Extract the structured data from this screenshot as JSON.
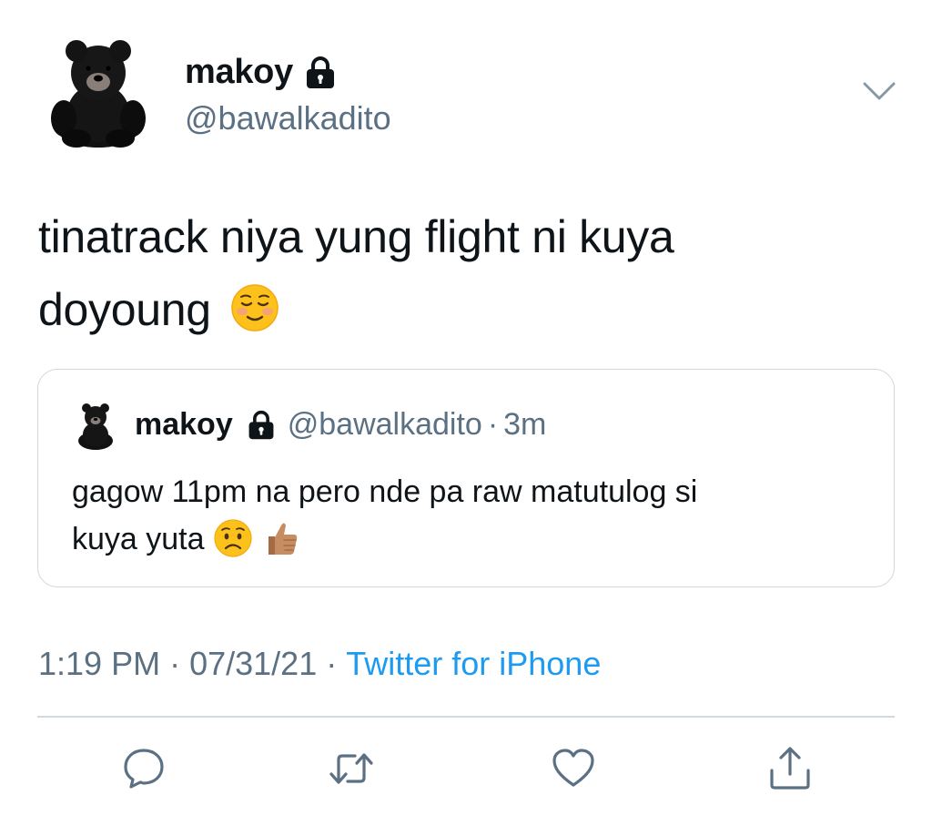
{
  "tweet": {
    "author": {
      "display_name": "makoy",
      "handle": "@bawalkadito",
      "avatar_icon": "teddy-bear-avatar",
      "protected_icon": "lock-icon"
    },
    "text_line1": "tinatrack niya yung flight ni kuya",
    "text_line2": "doyoung",
    "text_emoji": "smiling-face-emoji"
  },
  "quote": {
    "author": {
      "display_name": "makoy",
      "handle": "@bawalkadito",
      "separator": "·",
      "time": "3m"
    },
    "text_line1": "gagow 11pm na pero nde pa raw matutulog si",
    "text_line2": "kuya yuta",
    "emojis": [
      "worried-face-emoji",
      "thumbs-up-emoji"
    ]
  },
  "meta": {
    "time": "1:19 PM",
    "separator": "·",
    "date": "07/31/21",
    "source": "Twitter for iPhone"
  },
  "actions": [
    {
      "name": "reply",
      "icon": "reply-icon"
    },
    {
      "name": "retweet",
      "icon": "retweet-icon"
    },
    {
      "name": "like",
      "icon": "heart-icon"
    },
    {
      "name": "share",
      "icon": "share-icon"
    }
  ],
  "colors": {
    "text": "#0f1419",
    "secondary": "#5b7083",
    "link": "#1d9bf0",
    "border": "#cfd9de"
  }
}
